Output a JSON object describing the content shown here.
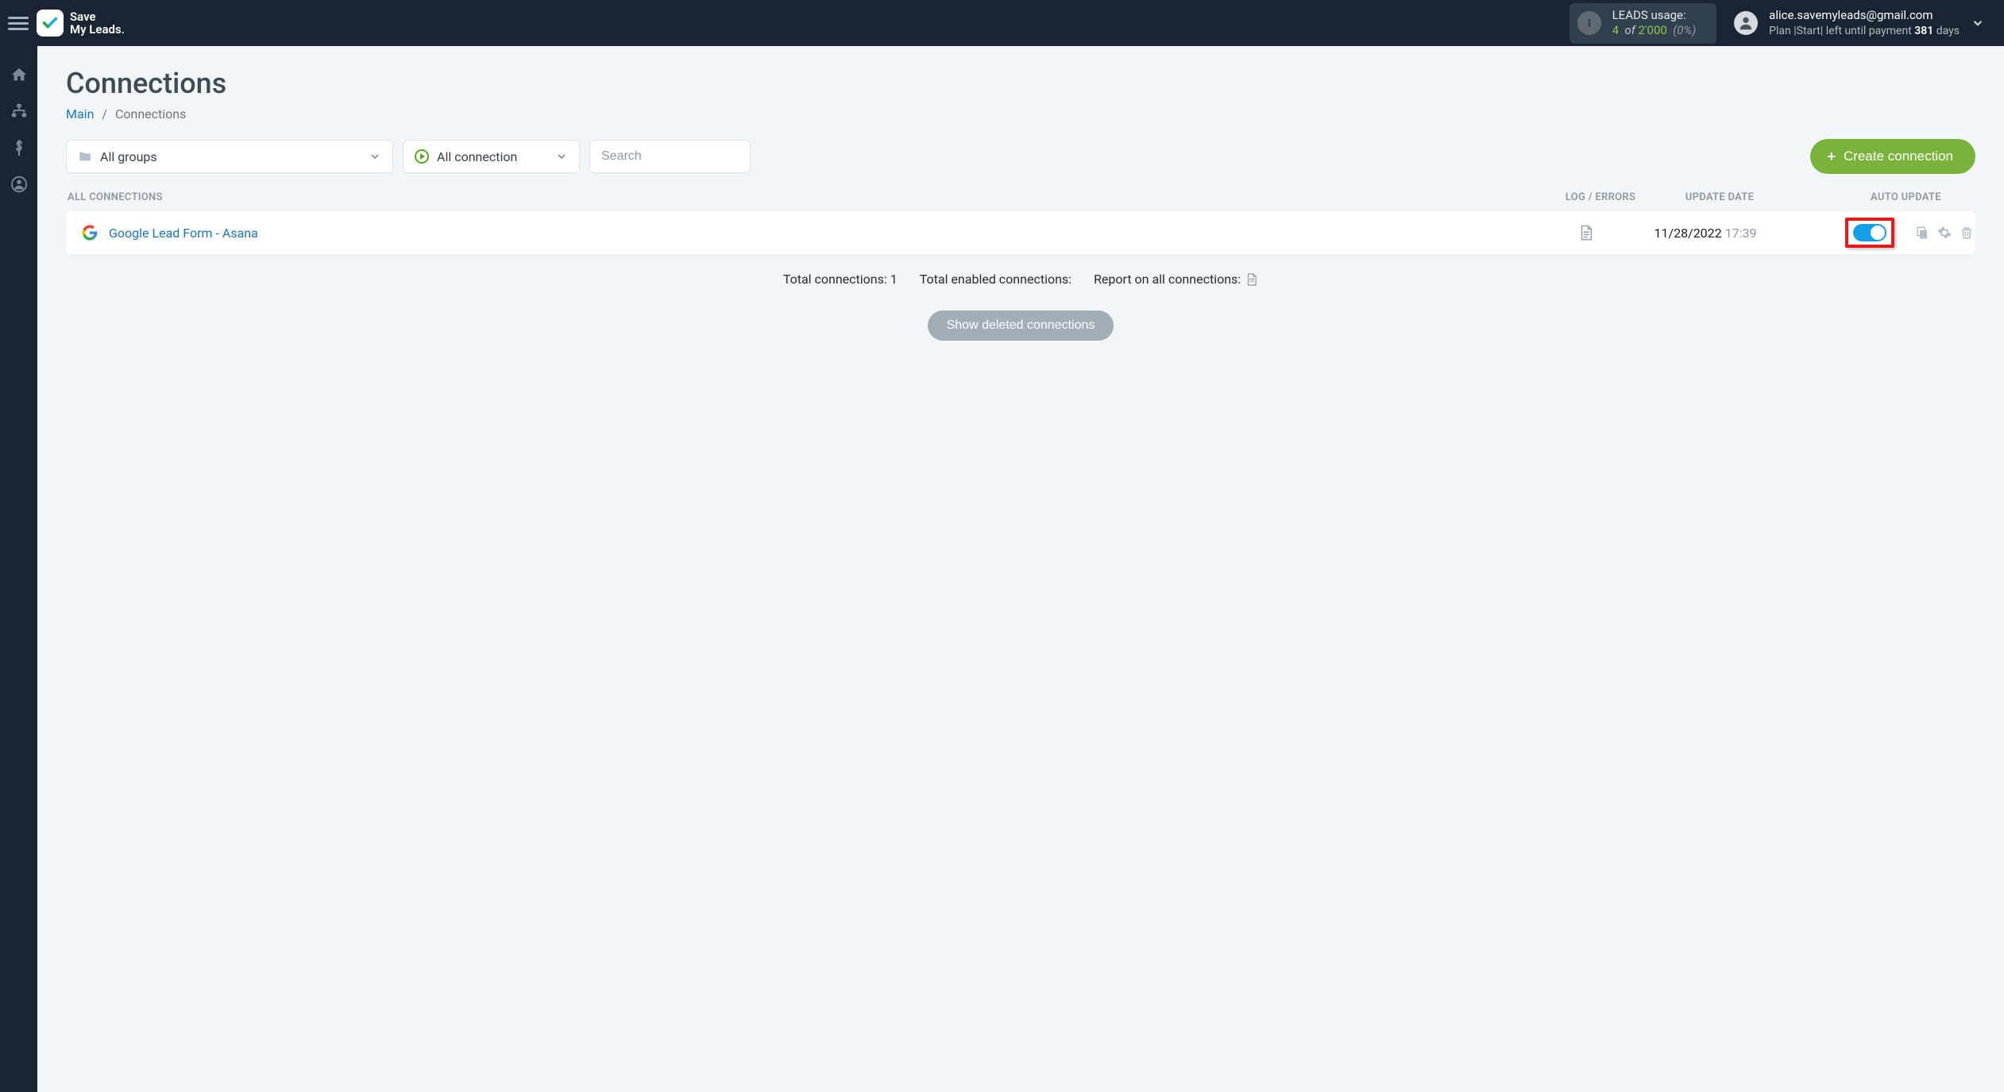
{
  "brand": {
    "line1": "Save",
    "line2": "My Leads"
  },
  "usage": {
    "label": "LEADS usage:",
    "used": "4",
    "of_word": "of",
    "total": "2'000",
    "pct": "(0%)"
  },
  "account": {
    "email": "alice.savemyleads@gmail.com",
    "plan_prefix": "Plan |",
    "plan_name": "Start",
    "plan_mid": "| left until payment ",
    "days_left": "381",
    "days_suffix": " days"
  },
  "page": {
    "title": "Connections",
    "breadcrumb_main": "Main",
    "breadcrumb_current": "Connections"
  },
  "filters": {
    "groups_label": "All groups",
    "status_label": "All connection",
    "search_placeholder": "Search",
    "create_button": "Create connection"
  },
  "columns": {
    "all": "All connections",
    "log": "Log / Errors",
    "date": "Update date",
    "auto": "Auto update"
  },
  "rows": [
    {
      "name": "Google Lead Form - Asana",
      "date": "11/28/2022",
      "time": "17:39",
      "auto_update": true
    }
  ],
  "stats": {
    "total_label": "Total connections: ",
    "total_value": "1",
    "enabled_label": "Total enabled connections:",
    "report_label": "Report on all connections:"
  },
  "show_deleted": "Show deleted connections"
}
